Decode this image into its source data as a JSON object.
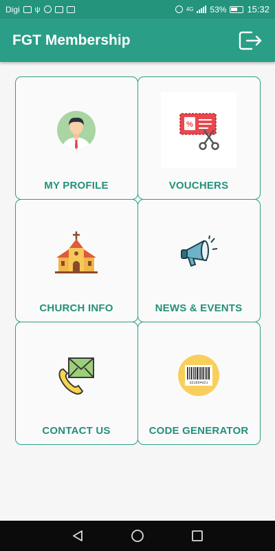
{
  "status_bar": {
    "carrier": "Digi",
    "battery_percent": "53%",
    "time": "15:32",
    "network": "4G"
  },
  "app_bar": {
    "title": "FGT Membership",
    "logout_icon": "logout-icon"
  },
  "menu": [
    {
      "label": "MY PROFILE",
      "icon": "profile-avatar-icon"
    },
    {
      "label": "VOUCHERS",
      "icon": "voucher-scissors-icon"
    },
    {
      "label": "CHURCH INFO",
      "icon": "church-icon"
    },
    {
      "label": "NEWS & EVENTS",
      "icon": "megaphone-icon"
    },
    {
      "label": "CONTACT US",
      "icon": "phone-mail-icon"
    },
    {
      "label": "CODE GENERATOR",
      "icon": "barcode-icon"
    }
  ],
  "colors": {
    "primary": "#2a9e86",
    "status_bar": "#24947c",
    "label": "#24907a",
    "background": "#f6f6f6"
  },
  "barcode_number": "321654321"
}
